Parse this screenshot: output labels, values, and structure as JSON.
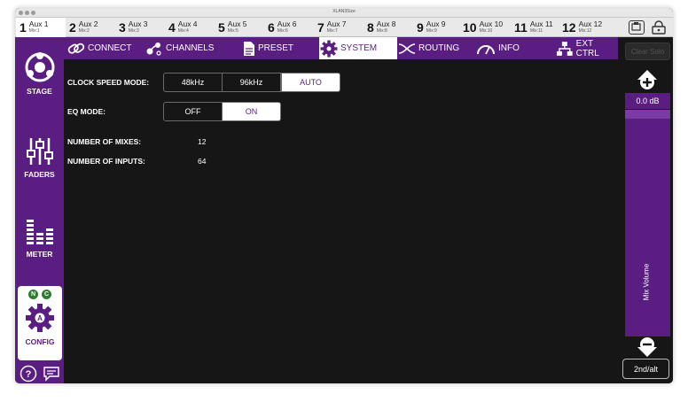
{
  "window": {
    "title": "XLAN3Size"
  },
  "mixes": [
    {
      "num": "1",
      "name": "Aux 1",
      "sub": "Mix:1"
    },
    {
      "num": "2",
      "name": "Aux 2",
      "sub": "Mix:2"
    },
    {
      "num": "3",
      "name": "Aux 3",
      "sub": "Mix:3"
    },
    {
      "num": "4",
      "name": "Aux 4",
      "sub": "Mix:4"
    },
    {
      "num": "5",
      "name": "Aux 5",
      "sub": "Mix:5"
    },
    {
      "num": "6",
      "name": "Aux 6",
      "sub": "Mix:6"
    },
    {
      "num": "7",
      "name": "Aux 7",
      "sub": "Mix:7"
    },
    {
      "num": "8",
      "name": "Aux 8",
      "sub": "Mix:8"
    },
    {
      "num": "9",
      "name": "Aux 9",
      "sub": "Mix:9"
    },
    {
      "num": "10",
      "name": "Aux 10",
      "sub": "Mix:10"
    },
    {
      "num": "11",
      "name": "Aux 11",
      "sub": "Mix:11"
    },
    {
      "num": "12",
      "name": "Aux 12",
      "sub": "Mix:12"
    }
  ],
  "selected_mix": "1",
  "sidebar": {
    "items": [
      {
        "label": "STAGE",
        "icon": "stage-icon"
      },
      {
        "label": "FADERS",
        "icon": "faders-icon"
      },
      {
        "label": "METER",
        "icon": "meter-icon"
      },
      {
        "label": "CONFIG",
        "icon": "config-gear-icon",
        "badges": [
          "N",
          "C"
        ]
      }
    ],
    "help_icon": "help-icon",
    "chat_icon": "message-icon"
  },
  "tabs": [
    {
      "label": "CONNECT",
      "icon": "link-icon"
    },
    {
      "label": "CHANNELS",
      "icon": "channels-icon"
    },
    {
      "label": "PRESET",
      "icon": "document-icon"
    },
    {
      "label": "SYSTEM",
      "icon": "gear-icon"
    },
    {
      "label": "ROUTING",
      "icon": "routing-icon"
    },
    {
      "label": "INFO",
      "icon": "gauge-icon"
    },
    {
      "label": "EXT CTRL",
      "icon": "network-icon"
    }
  ],
  "active_tab": "SYSTEM",
  "system": {
    "clock_label": "CLOCK SPEED MODE:",
    "clock_options": [
      "48kHz",
      "96kHz",
      "AUTO"
    ],
    "clock_selected": "AUTO",
    "eq_label": "EQ MODE:",
    "eq_options": [
      "OFF",
      "ON"
    ],
    "eq_selected": "ON",
    "mixes_label": "NUMBER OF MIXES:",
    "mixes_value": "12",
    "inputs_label": "NUMBER OF INPUTS:",
    "inputs_value": "64"
  },
  "right_panel": {
    "clear_solo": "Clear Solo",
    "db_value": "0.0 dB",
    "mix_volume_label": "Mix Volume",
    "alt_button": "2nd/alt",
    "fader_level": 1.0
  },
  "colors": {
    "accent": "#5a1d82",
    "background": "#161616"
  }
}
